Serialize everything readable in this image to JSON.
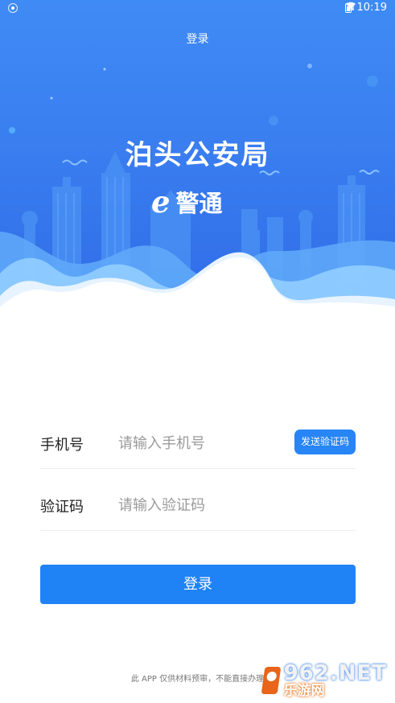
{
  "status_bar": {
    "time": "10:19",
    "icons": [
      "shield-icon",
      "wifi-icon",
      "signal-icon",
      "battery-icon"
    ]
  },
  "header": {
    "title": "登录"
  },
  "brand": {
    "title": "泊头公安局",
    "logo_mark": "e",
    "logo_text": "警通"
  },
  "form": {
    "phone": {
      "label": "手机号",
      "placeholder": "请输入手机号",
      "send_code_label": "发送验证码"
    },
    "code": {
      "label": "验证码",
      "placeholder": "请输入验证码"
    }
  },
  "actions": {
    "login_label": "登录"
  },
  "footer": {
    "note": "此 APP 仅供材料预审，不能直接办理"
  },
  "watermark": {
    "top": "962.NET",
    "bottom": "乐游网"
  },
  "colors": {
    "hero_start": "#3f8bf5",
    "hero_end": "#2f6be6",
    "primary_button": "#1f82f5"
  }
}
